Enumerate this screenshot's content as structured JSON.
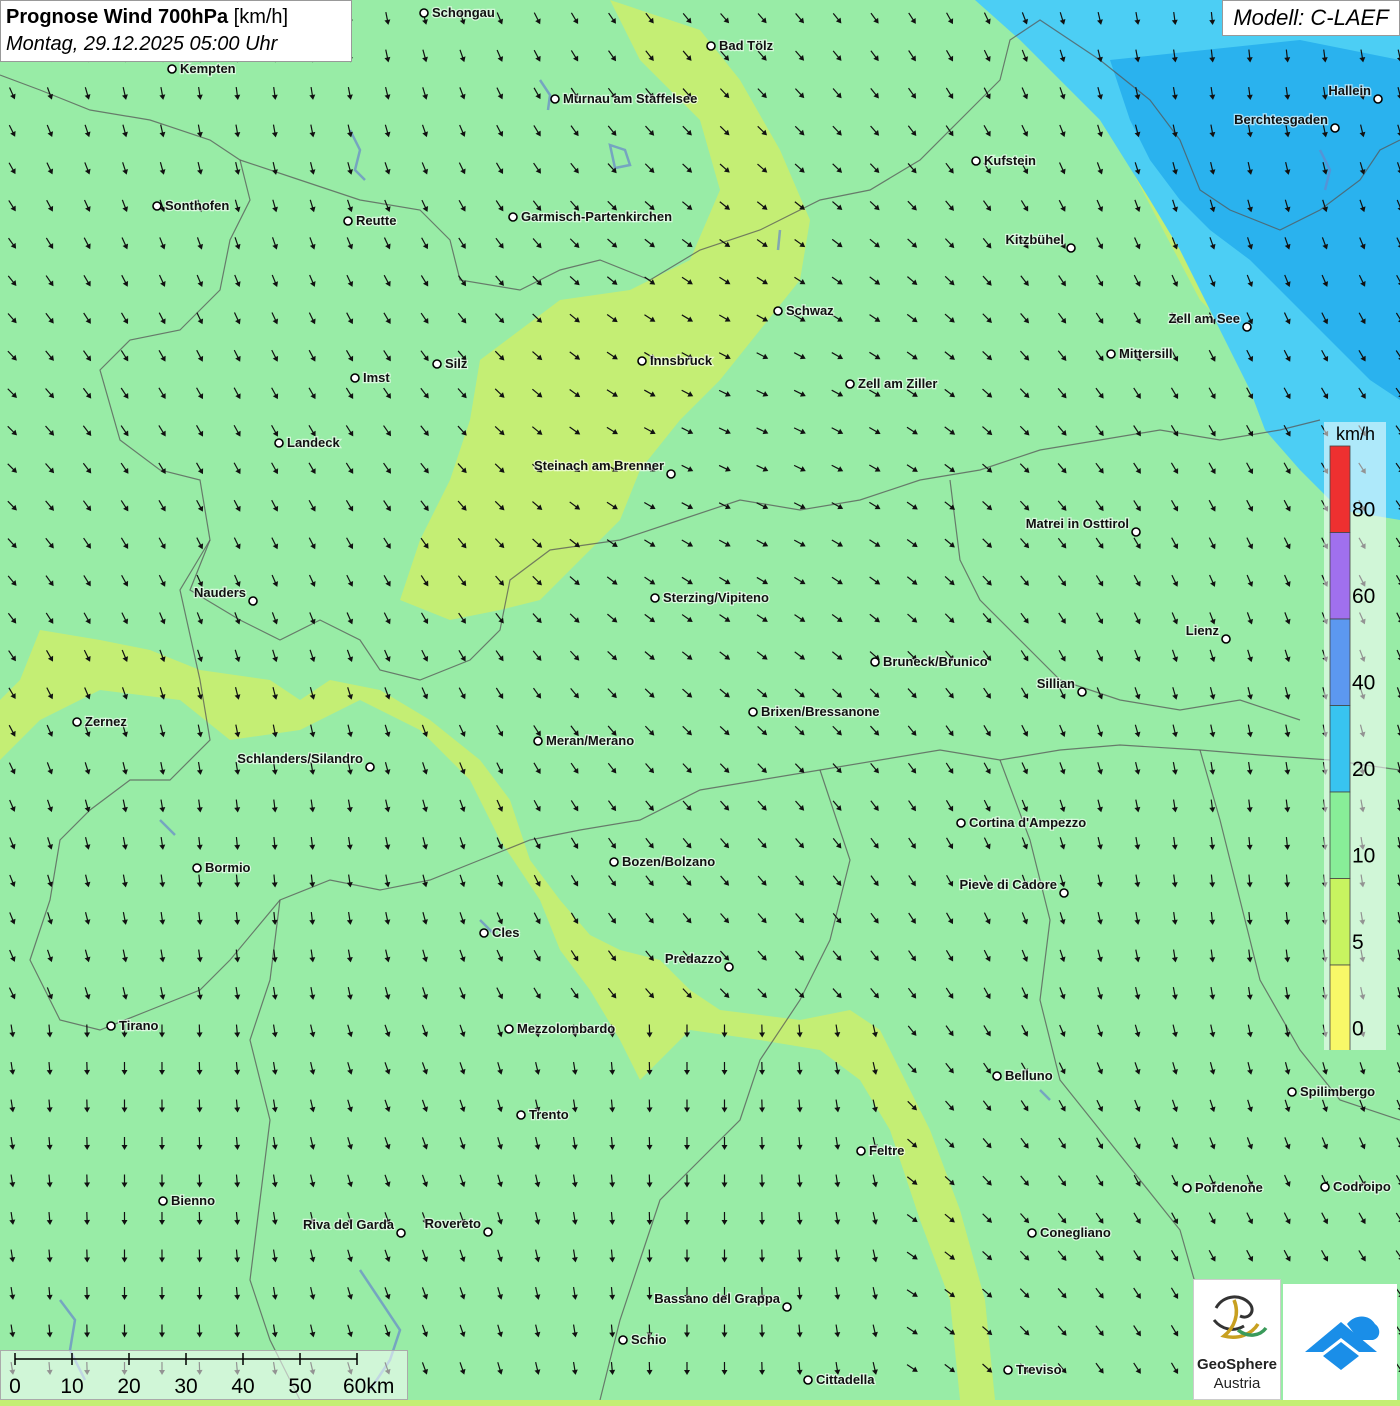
{
  "header": {
    "title_bold": "Prognose Wind 700hPa",
    "title_unit": "[km/h]",
    "datetime": "Montag, 29.12.2025 05:00 Uhr",
    "model": "Modell: C-LAEF"
  },
  "legend": {
    "unit": "km/h",
    "ticks": [
      "80",
      "60",
      "40",
      "20",
      "10",
      "5",
      "0"
    ],
    "colors": [
      "#ee3030",
      "#a070ee",
      "#5c98f0",
      "#38c4f0",
      "#88ee98",
      "#c8f460",
      "#f8f868"
    ]
  },
  "scalebar": {
    "labels": [
      "0",
      "10",
      "20",
      "30",
      "40",
      "50",
      "60km"
    ]
  },
  "logos": {
    "geosphere_name": "GeoSphere",
    "geosphere_sub": "Austria"
  },
  "colors": {
    "calm_zone": "#c4ee74",
    "moderate_zone": "#98eca6",
    "strong_zone": "#4ccef4",
    "stronger_zone": "#2ab2ee"
  },
  "cities": [
    {
      "name": "Schongau",
      "side": "r"
    },
    {
      "name": "Kempten",
      "side": "r"
    },
    {
      "name": "Bad Tölz",
      "side": "r"
    },
    {
      "name": "Murnau am Staffelsee",
      "side": "r"
    },
    {
      "name": "Hallein",
      "side": "l"
    },
    {
      "name": "Berchtesgaden",
      "side": "l"
    },
    {
      "name": "Kufstein",
      "side": "r"
    },
    {
      "name": "Sonthofen",
      "side": "r"
    },
    {
      "name": "Reutte",
      "side": "r"
    },
    {
      "name": "Garmisch-Partenkirchen",
      "side": "r"
    },
    {
      "name": "Kitzbühel",
      "side": "l"
    },
    {
      "name": "Schwaz",
      "side": "r"
    },
    {
      "name": "Zell am See",
      "side": "l"
    },
    {
      "name": "Innsbruck",
      "side": "r"
    },
    {
      "name": "Mittersill",
      "side": "r"
    },
    {
      "name": "Silz",
      "side": "r"
    },
    {
      "name": "Imst",
      "side": "r"
    },
    {
      "name": "Zell am Ziller",
      "side": "r"
    },
    {
      "name": "Landeck",
      "side": "r"
    },
    {
      "name": "Steinach am Brenner",
      "side": "l"
    },
    {
      "name": "Matrei in Osttirol",
      "side": "l"
    },
    {
      "name": "Nauders",
      "side": "l"
    },
    {
      "name": "Sterzing/Vipiteno",
      "side": "r"
    },
    {
      "name": "Lienz",
      "side": "l"
    },
    {
      "name": "Bruneck/Brunico",
      "side": "r"
    },
    {
      "name": "Sillian",
      "side": "l"
    },
    {
      "name": "Zernez",
      "side": "r"
    },
    {
      "name": "Brixen/Bressanone",
      "side": "r"
    },
    {
      "name": "Meran/Merano",
      "side": "r"
    },
    {
      "name": "Schlanders/Silandro",
      "side": "l"
    },
    {
      "name": "Cortina d'Ampezzo",
      "side": "r"
    },
    {
      "name": "Bozen/Bolzano",
      "side": "r"
    },
    {
      "name": "Bormio",
      "side": "r"
    },
    {
      "name": "Pieve di Cadore",
      "side": "l"
    },
    {
      "name": "Cles",
      "side": "r"
    },
    {
      "name": "Predazzo",
      "side": "l"
    },
    {
      "name": "Tirano",
      "side": "r"
    },
    {
      "name": "Mezzolombardo",
      "side": "r"
    },
    {
      "name": "Belluno",
      "side": "r"
    },
    {
      "name": "Spilimbergo",
      "side": "r"
    },
    {
      "name": "Trento",
      "side": "r"
    },
    {
      "name": "Feltre",
      "side": "r"
    },
    {
      "name": "Pordenone",
      "side": "r"
    },
    {
      "name": "Codroipo",
      "side": "r"
    },
    {
      "name": "Bienno",
      "side": "r"
    },
    {
      "name": "Riva del Garda",
      "side": "l"
    },
    {
      "name": "Rovereto",
      "side": "l"
    },
    {
      "name": "Conegliano",
      "side": "r"
    },
    {
      "name": "Bassano del Grappa",
      "side": "l"
    },
    {
      "name": "Schio",
      "side": "r"
    },
    {
      "name": "Treviso",
      "side": "r"
    },
    {
      "name": "Cittadella",
      "side": "r"
    }
  ]
}
